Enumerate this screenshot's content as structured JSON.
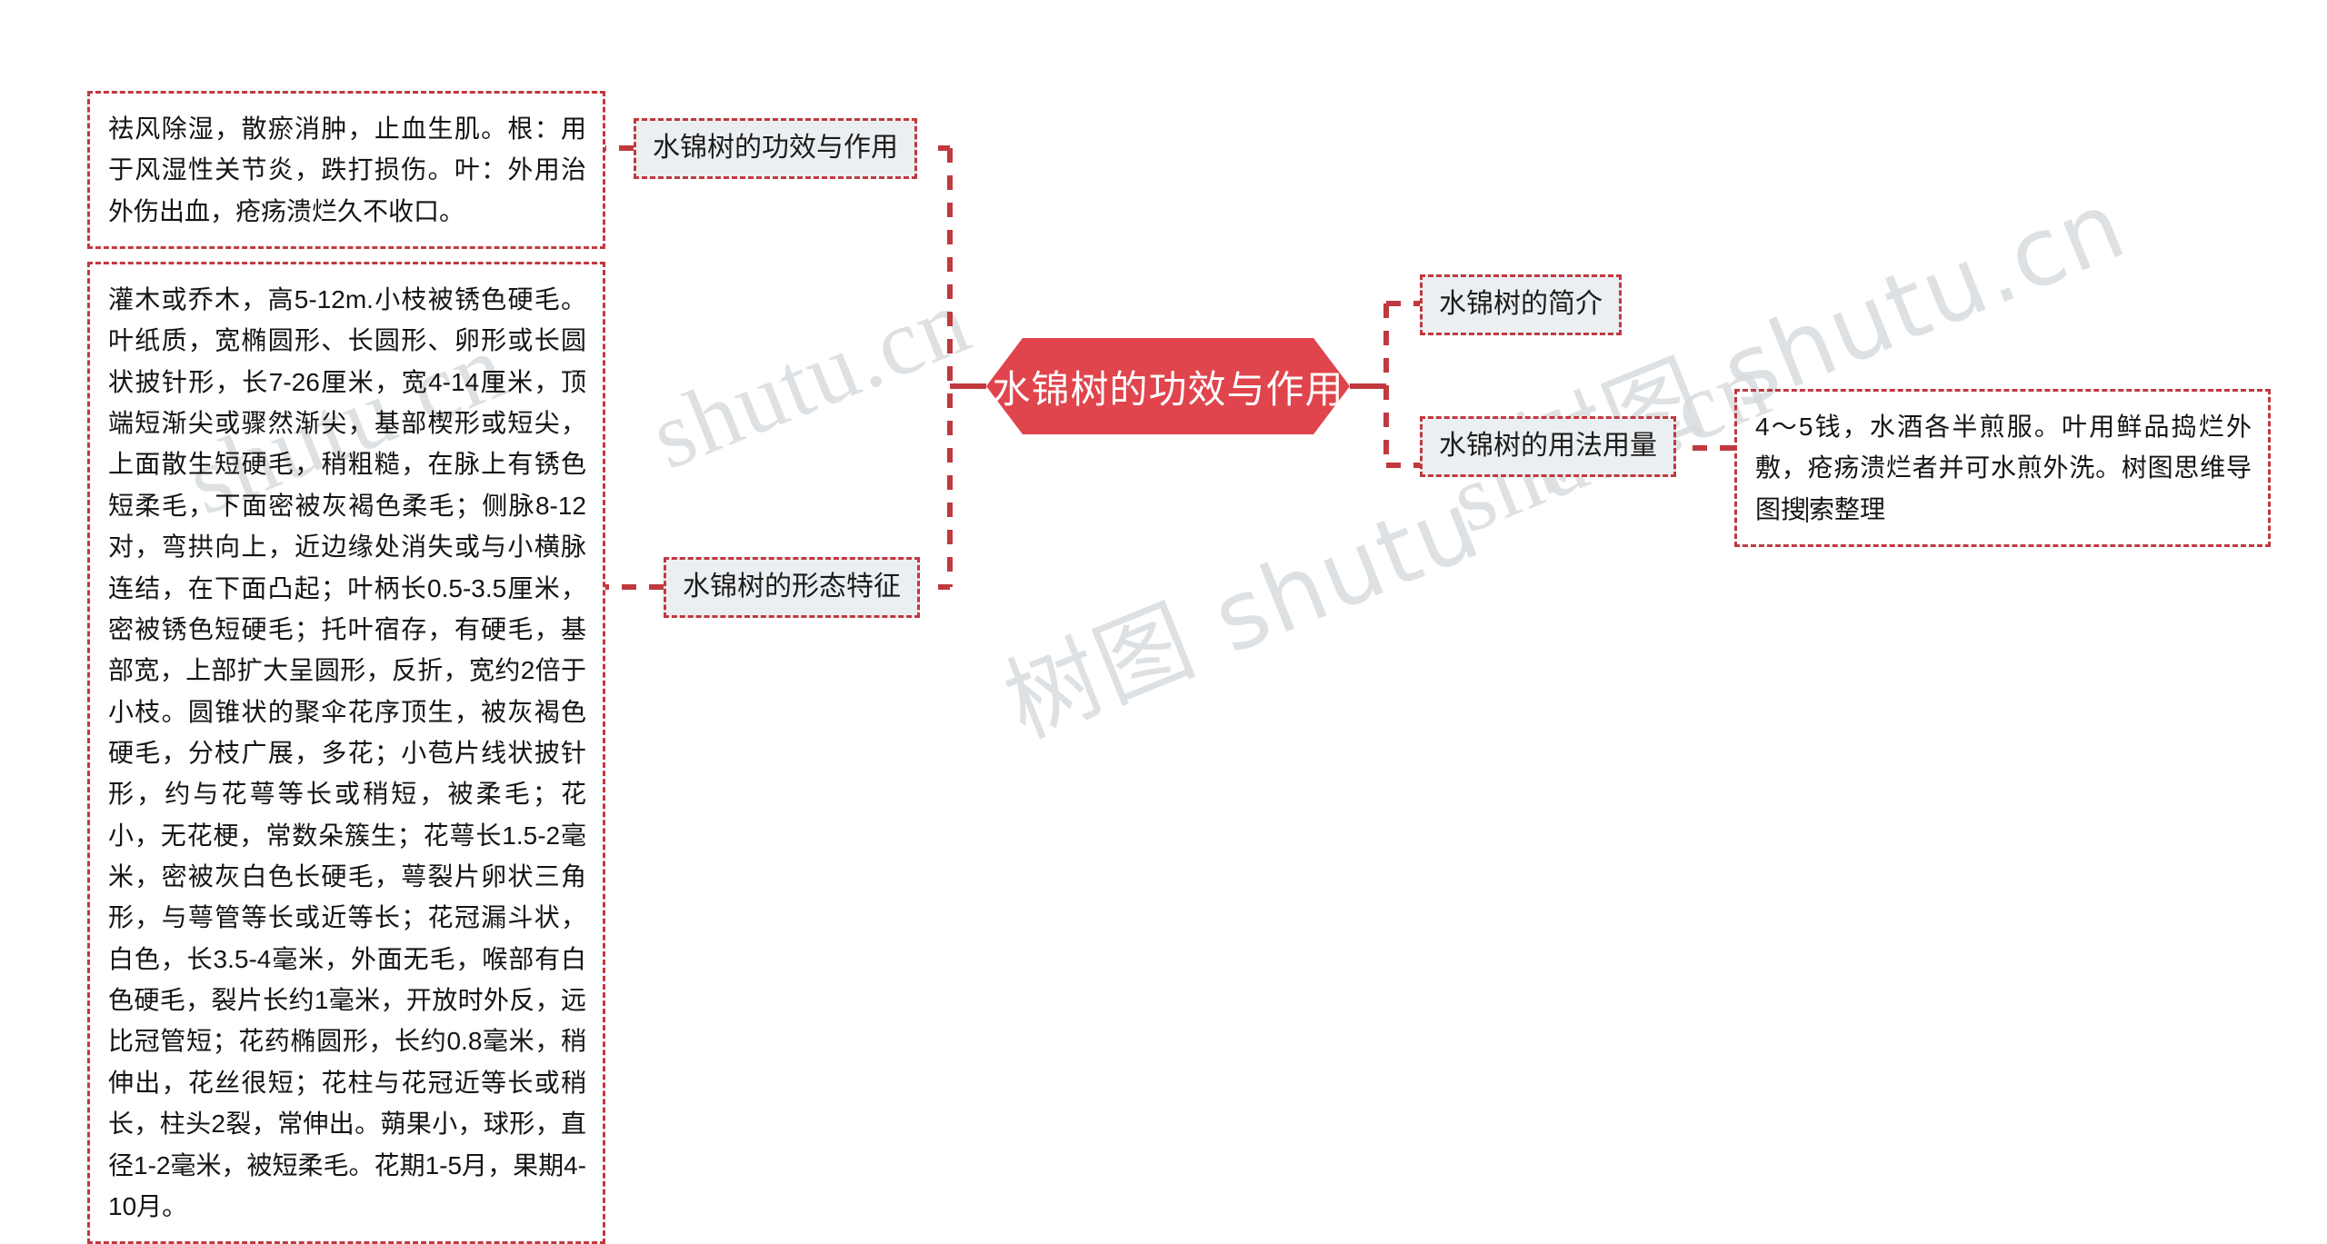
{
  "meta": {
    "background": "#ffffff",
    "accent_red": "#e0444c",
    "border_red": "#c0393f",
    "node_fill": "#eceff1",
    "watermark_color": "#d9dcdf"
  },
  "root": {
    "label": "水锦树的功效与作用"
  },
  "branches": {
    "effect": {
      "label": "水锦树的功效与作用",
      "detail": "祛风除湿，散瘀消肿，止血生肌。根：用于风湿性关节炎，跌打损伤。叶：外用治外伤出血，疮疡溃烂久不收口。"
    },
    "morphology": {
      "label": "水锦树的形态特征",
      "detail": "灌木或乔木，高5-12m.小枝被锈色硬毛。叶纸质，宽椭圆形、长圆形、卵形或长圆状披针形，长7-26厘米，宽4-14厘米，顶端短渐尖或骤然渐尖，基部楔形或短尖，上面散生短硬毛，稍粗糙，在脉上有锈色短柔毛，下面密被灰褐色柔毛；侧脉8-12对，弯拱向上，近边缘处消失或与小横脉连结，在下面凸起；叶柄长0.5-3.5厘米，密被锈色短硬毛；托叶宿存，有硬毛，基部宽，上部扩大呈圆形，反折，宽约2倍于小枝。圆锥状的聚伞花序顶生，被灰褐色硬毛，分枝广展，多花；小苞片线状披针形，约与花萼等长或稍短，被柔毛；花小，无花梗，常数朵簇生；花萼长1.5-2毫米，密被灰白色长硬毛，萼裂片卵状三角形，与萼管等长或近等长；花冠漏斗状，白色，长3.5-4毫米，外面无毛，喉部有白色硬毛，裂片长约1毫米，开放时外反，远比冠管短；花药椭圆形，长约0.8毫米，稍伸出，花丝很短；花柱与花冠近等长或稍长，柱头2裂，常伸出。蒴果小，球形，直径1-2毫米，被短柔毛。花期1-5月，果期4-10月。"
    },
    "intro": {
      "label": "水锦树的简介"
    },
    "dosage": {
      "label": "水锦树的用法用量",
      "detail_prefix": "4～5钱，水酒各半煎服。叶用鲜品捣烂外敷，疮疡溃烂者并可水煎外洗。树图思维导图搜",
      "detail_suffix": "索整理"
    }
  },
  "watermarks": {
    "a": "shutu.cn",
    "b": "shutu.cn",
    "c": "树图 shutu.cn",
    "d": "树图 shutu",
    "e": "shutu.cn"
  }
}
